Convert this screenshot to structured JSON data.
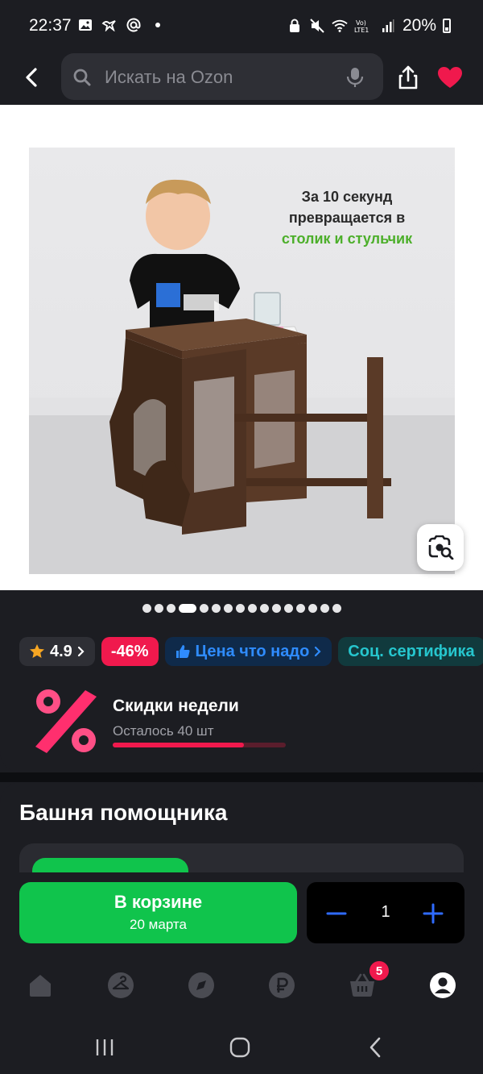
{
  "status_bar": {
    "time": "22:37",
    "battery": "20%",
    "icons": [
      "image-icon",
      "bird-icon",
      "at-icon",
      "dot-icon",
      "lock-icon",
      "mute-icon",
      "wifi-icon",
      "lte-icon",
      "signal-icon",
      "battery-icon"
    ]
  },
  "header": {
    "search_placeholder": "Искать на Ozon",
    "icons": [
      "back-arrow-icon",
      "search-icon",
      "microphone-icon",
      "share-icon",
      "heart-icon"
    ],
    "heart_color": "#f0194d"
  },
  "gallery": {
    "caption_line1": "За 10 секунд",
    "caption_line2": "превращается в",
    "caption_line3": "столик и стульчик",
    "caption_accent_color": "#4caf2a",
    "dots_total": 16,
    "dots_active_index": 3
  },
  "badges": {
    "rating": "4.9",
    "discount": "-46%",
    "price_label": "Цена что надо",
    "cert_label": "Соц. сертифика"
  },
  "deals": {
    "title": "Скидки недели",
    "remaining": "Осталось 40 шт",
    "remaining_fraction": 0.76
  },
  "product": {
    "title": "Башня помощника"
  },
  "action_bar": {
    "cart_label": "В корзине",
    "cart_date": "20 марта",
    "quantity": "1",
    "accent_color": "#10c44c"
  },
  "bottom_nav": {
    "items": [
      "home-icon",
      "hanger-icon",
      "compass-icon",
      "ruble-icon",
      "basket-icon",
      "profile-icon"
    ],
    "cart_count": "5"
  }
}
